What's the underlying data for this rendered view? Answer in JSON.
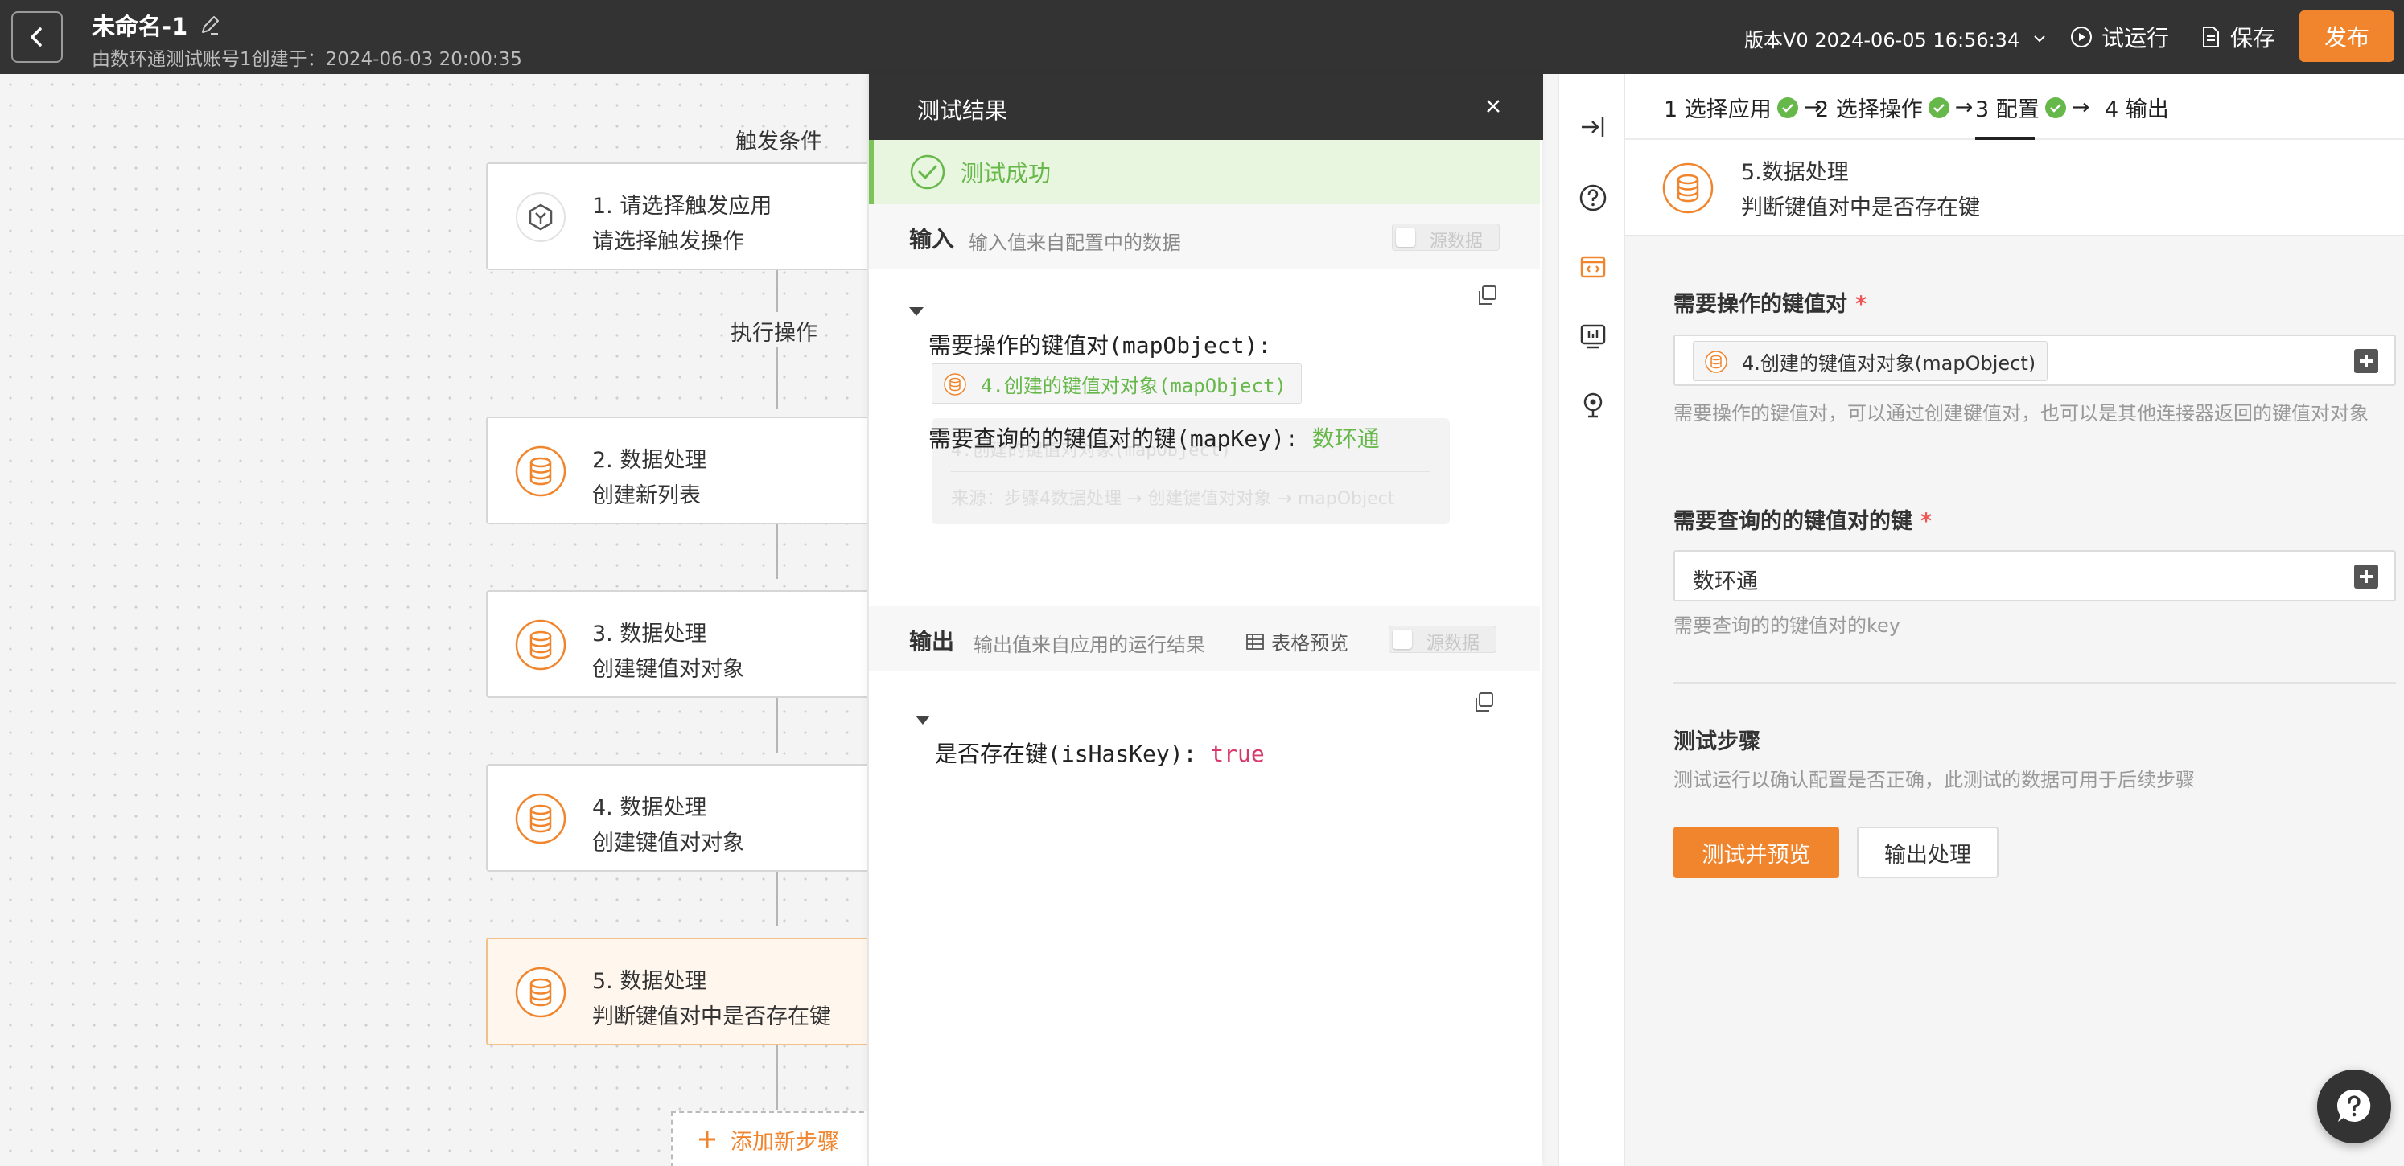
{
  "topbar": {
    "title": "未命名-1",
    "subtitle": "由数环通测试账号1创建于：2024-06-03 20:00:35",
    "version": "版本V0 2024-06-05 16:56:34",
    "trial_run": "试运行",
    "save": "保存",
    "publish": "发布"
  },
  "canvas": {
    "trigger_label": "触发条件",
    "action_label": "执行操作",
    "nodes": [
      {
        "title": "1. 请选择触发应用",
        "subtitle": "请选择触发操作",
        "icon": "hexagon-app-icon"
      },
      {
        "title": "2. 数据处理",
        "subtitle": "创建新列表",
        "icon": "database-icon"
      },
      {
        "title": "3. 数据处理",
        "subtitle": "创建键值对对象",
        "icon": "database-icon"
      },
      {
        "title": "4. 数据处理",
        "subtitle": "创建键值对对象",
        "icon": "database-icon"
      },
      {
        "title": "5. 数据处理",
        "subtitle": "判断键值对中是否存在键",
        "icon": "database-icon"
      }
    ],
    "add_step": "添加新步骤"
  },
  "test_panel": {
    "title": "测试结果",
    "success": "测试成功",
    "input": {
      "title": "输入",
      "desc": "输入值来自配置中的数据",
      "raw_toggle": "源数据",
      "line1_key": "需要操作的键值对(mapObject):",
      "line1_ref": "4.创建的键值对对象(mapObject)",
      "line2_key": "需要查询的的键值对的键(mapKey):",
      "line2_val": "数环通",
      "tooltip_line1": "4.创建的键值对对象(mapObject)",
      "tooltip_line2": "来源：步骤4数据处理 → 创建键值对对象 → mapObject"
    },
    "output": {
      "title": "输出",
      "desc": "输出值来自应用的运行结果",
      "table_preview": "表格预览",
      "raw_toggle": "源数据",
      "line1_key": "是否存在键(isHasKey):",
      "line1_val": "true"
    }
  },
  "config": {
    "steps": [
      {
        "label": "1 选择应用",
        "done": true
      },
      {
        "label": "2 选择操作",
        "done": true
      },
      {
        "label": "3 配置",
        "done": true
      },
      {
        "label": "4 输出",
        "done": false
      }
    ],
    "arrow": "→",
    "node_title": "5.数据处理",
    "node_subtitle": "判断键值对中是否存在键",
    "field1": {
      "label": "需要操作的键值对",
      "required": "*",
      "chip": "4.创建的键值对对象(mapObject)",
      "help": "需要操作的键值对，可以通过创建键值对，也可以是其他连接器返回的键值对对象"
    },
    "field2": {
      "label": "需要查询的的键值对的键",
      "required": "*",
      "value": "数环通",
      "help": "需要查询的的键值对的key"
    },
    "test_section": {
      "title": "测试步骤",
      "desc": "测试运行以确认配置是否正确，此测试的数据可用于后续步骤",
      "primary_button": "测试并预览",
      "secondary_button": "输出处理"
    }
  },
  "colors": {
    "accent": "#f0852d",
    "success": "#67b84a",
    "dark": "#333333"
  }
}
